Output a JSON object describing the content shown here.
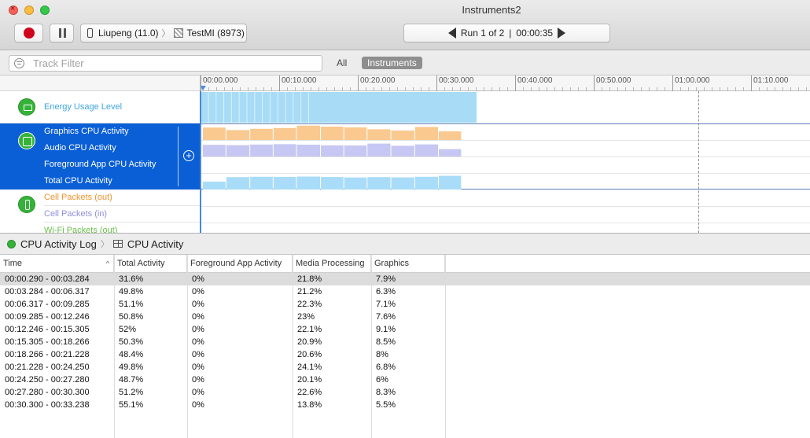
{
  "window": {
    "title": "Instruments2"
  },
  "toolbar": {
    "device": "Liupeng (11.0)",
    "process": "TestMI (8973)",
    "run_label": "Run 1 of 2",
    "run_sep": "|",
    "run_time": "00:00:35"
  },
  "filter": {
    "placeholder": "Track Filter",
    "scope_all": "All",
    "scope_instruments": "Instruments"
  },
  "ruler": {
    "ticks": [
      "00:00.000",
      "00:10.000",
      "00:20.000",
      "00:30.000",
      "00:40.000",
      "00:50.000",
      "01:00.000",
      "01:10.000"
    ]
  },
  "tracks": {
    "energy": {
      "label": "Energy Usage Level"
    },
    "cpu": {
      "graphics_label": "Graphics CPU Activity",
      "audio_label": "Audio CPU Activity",
      "foreground_label": "Foreground App CPU Activity",
      "total_label": "Total CPU Activity"
    },
    "network": {
      "cell_out": "Cell Packets (out)",
      "cell_in": "Cell Packets (in)",
      "wifi_out": "Wi-Fi Packets (out)"
    }
  },
  "colors": {
    "selection": "#0a5fd6",
    "energy": "#a8dcf6",
    "graphics": "#f9c98f",
    "audio": "#c7c7f3",
    "total": "#a9dcf8",
    "cell_out": "#f0932e",
    "cell_in": "#8f8fe0",
    "wifi_out": "#6cc04a"
  },
  "detail": {
    "crumb_log": "CPU Activity Log",
    "crumb_view": "CPU Activity"
  },
  "table": {
    "columns": [
      "Time",
      "Total Activity",
      "Foreground App Activity",
      "Media Processing",
      "Graphics"
    ],
    "rows": [
      [
        "00:00.290 - 00:03.284",
        "31.6%",
        "0%",
        "21.8%",
        "7.9%"
      ],
      [
        "00:03.284 - 00:06.317",
        "49.8%",
        "0%",
        "21.2%",
        "6.3%"
      ],
      [
        "00:06.317 - 00:09.285",
        "51.1%",
        "0%",
        "22.3%",
        "7.1%"
      ],
      [
        "00:09.285 - 00:12.246",
        "50.8%",
        "0%",
        "23%",
        "7.6%"
      ],
      [
        "00:12.246 - 00:15.305",
        "52%",
        "0%",
        "22.1%",
        "9.1%"
      ],
      [
        "00:15.305 - 00:18.266",
        "50.3%",
        "0%",
        "20.9%",
        "8.5%"
      ],
      [
        "00:18.266 - 00:21.228",
        "48.4%",
        "0%",
        "20.6%",
        "8%"
      ],
      [
        "00:21.228 - 00:24.250",
        "49.8%",
        "0%",
        "24.1%",
        "6.8%"
      ],
      [
        "00:24.250 - 00:27.280",
        "48.7%",
        "0%",
        "20.1%",
        "6%"
      ],
      [
        "00:27.280 - 00:30.300",
        "51.2%",
        "0%",
        "22.6%",
        "8.3%"
      ],
      [
        "00:30.300 - 00:33.238",
        "55.1%",
        "0%",
        "13.8%",
        "5.5%"
      ]
    ]
  },
  "timeline": {
    "seconds_per_tick": 10,
    "energy_end_s": 35,
    "dashed_marker_s": 63.3
  }
}
